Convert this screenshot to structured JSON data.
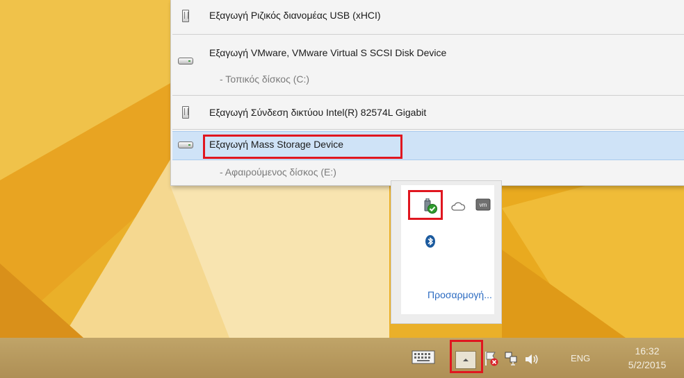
{
  "eject_menu": {
    "items": [
      {
        "label": "Εξαγωγή Ριζικός διανομέας USB (xHCI)",
        "icon": "usb-device-icon"
      },
      {
        "label": "Εξαγωγή VMware, VMware Virtual S SCSI Disk Device",
        "icon": "disk-drive-icon",
        "sub": "- Τοπικός δίσκος (C:)"
      },
      {
        "label": "Εξαγωγή Σύνδεση δικτύου Intel(R) 82574L Gigabit",
        "icon": "usb-device-icon"
      },
      {
        "label": "Εξαγωγή Mass Storage Device",
        "icon": "disk-drive-icon",
        "sub": "- Αφαιρούμενος δίσκος (E:)",
        "selected": true
      }
    ]
  },
  "tray_flyout": {
    "icons": [
      "safely-remove-hardware-icon",
      "onedrive-cloud-icon",
      "vmware-tools-icon",
      "bluetooth-icon"
    ],
    "customize_link": "Προσαρμογή..."
  },
  "taskbar": {
    "icons": [
      "touch-keyboard-icon",
      "show-hidden-icons-chevron",
      "action-center-flag-icon",
      "network-icon",
      "volume-icon"
    ],
    "language": "ENG",
    "time": "16:32",
    "date": "5/2/2015"
  },
  "colors": {
    "highlight_callout": "#e0161f",
    "selected_row": "#cfe3f7",
    "link": "#2a6ac1",
    "wallpaper_orange": "#e8a81c"
  }
}
